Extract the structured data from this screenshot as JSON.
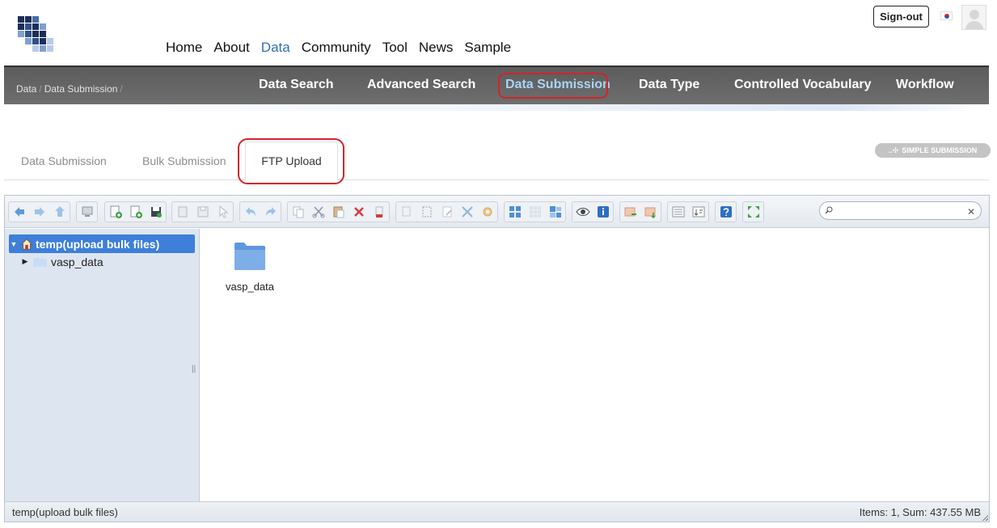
{
  "header": {
    "nav": [
      {
        "label": "Home"
      },
      {
        "label": "About"
      },
      {
        "label": "Data",
        "active": true
      },
      {
        "label": "Community"
      },
      {
        "label": "Tool"
      },
      {
        "label": "News"
      },
      {
        "label": "Sample"
      }
    ],
    "signout_label": "Sign-out"
  },
  "subbar": {
    "breadcrumb": [
      "Data",
      "Data Submission"
    ],
    "nav": [
      {
        "label": "Data Search"
      },
      {
        "label": "Advanced Search"
      },
      {
        "label": "Data Submission",
        "active": true
      },
      {
        "label": "Data Type"
      },
      {
        "label": "Controlled Vocabulary"
      },
      {
        "label": "Workflow"
      }
    ]
  },
  "tabs": [
    {
      "label": "Data Submission"
    },
    {
      "label": "Bulk Submission"
    },
    {
      "label": "FTP Upload",
      "active": true
    }
  ],
  "simple_submission_label": "SIMPLE SUBMISSION",
  "filemanager": {
    "search": {
      "placeholder": "",
      "value": ""
    },
    "tree": {
      "root": "temp(upload bulk files)",
      "children": [
        "vasp_data"
      ]
    },
    "files": [
      {
        "name": "vasp_data",
        "type": "folder"
      }
    ],
    "status": {
      "path": "temp(upload bulk files)",
      "summary": "Items: 1, Sum: 437.55 MB"
    }
  },
  "colors": {
    "accent": "#2d6fb8",
    "highlight_ring": "#d2242a",
    "tree_selected": "#3d7fd9",
    "dark_bar": "#636363"
  }
}
